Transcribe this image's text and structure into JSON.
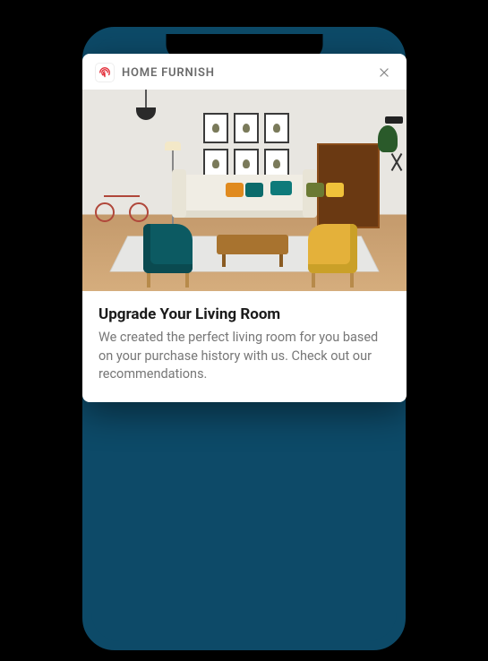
{
  "notification": {
    "app_name": "HOME FURNISH",
    "title": "Upgrade Your Living Room",
    "description": "We created the perfect living room for you based on your purchase history with us. Check out our recommendations."
  },
  "icons": {
    "app": "fingerprint-icon",
    "close": "close-icon"
  },
  "colors": {
    "phone_body": "#0d4a68",
    "accent": "#e22934"
  }
}
